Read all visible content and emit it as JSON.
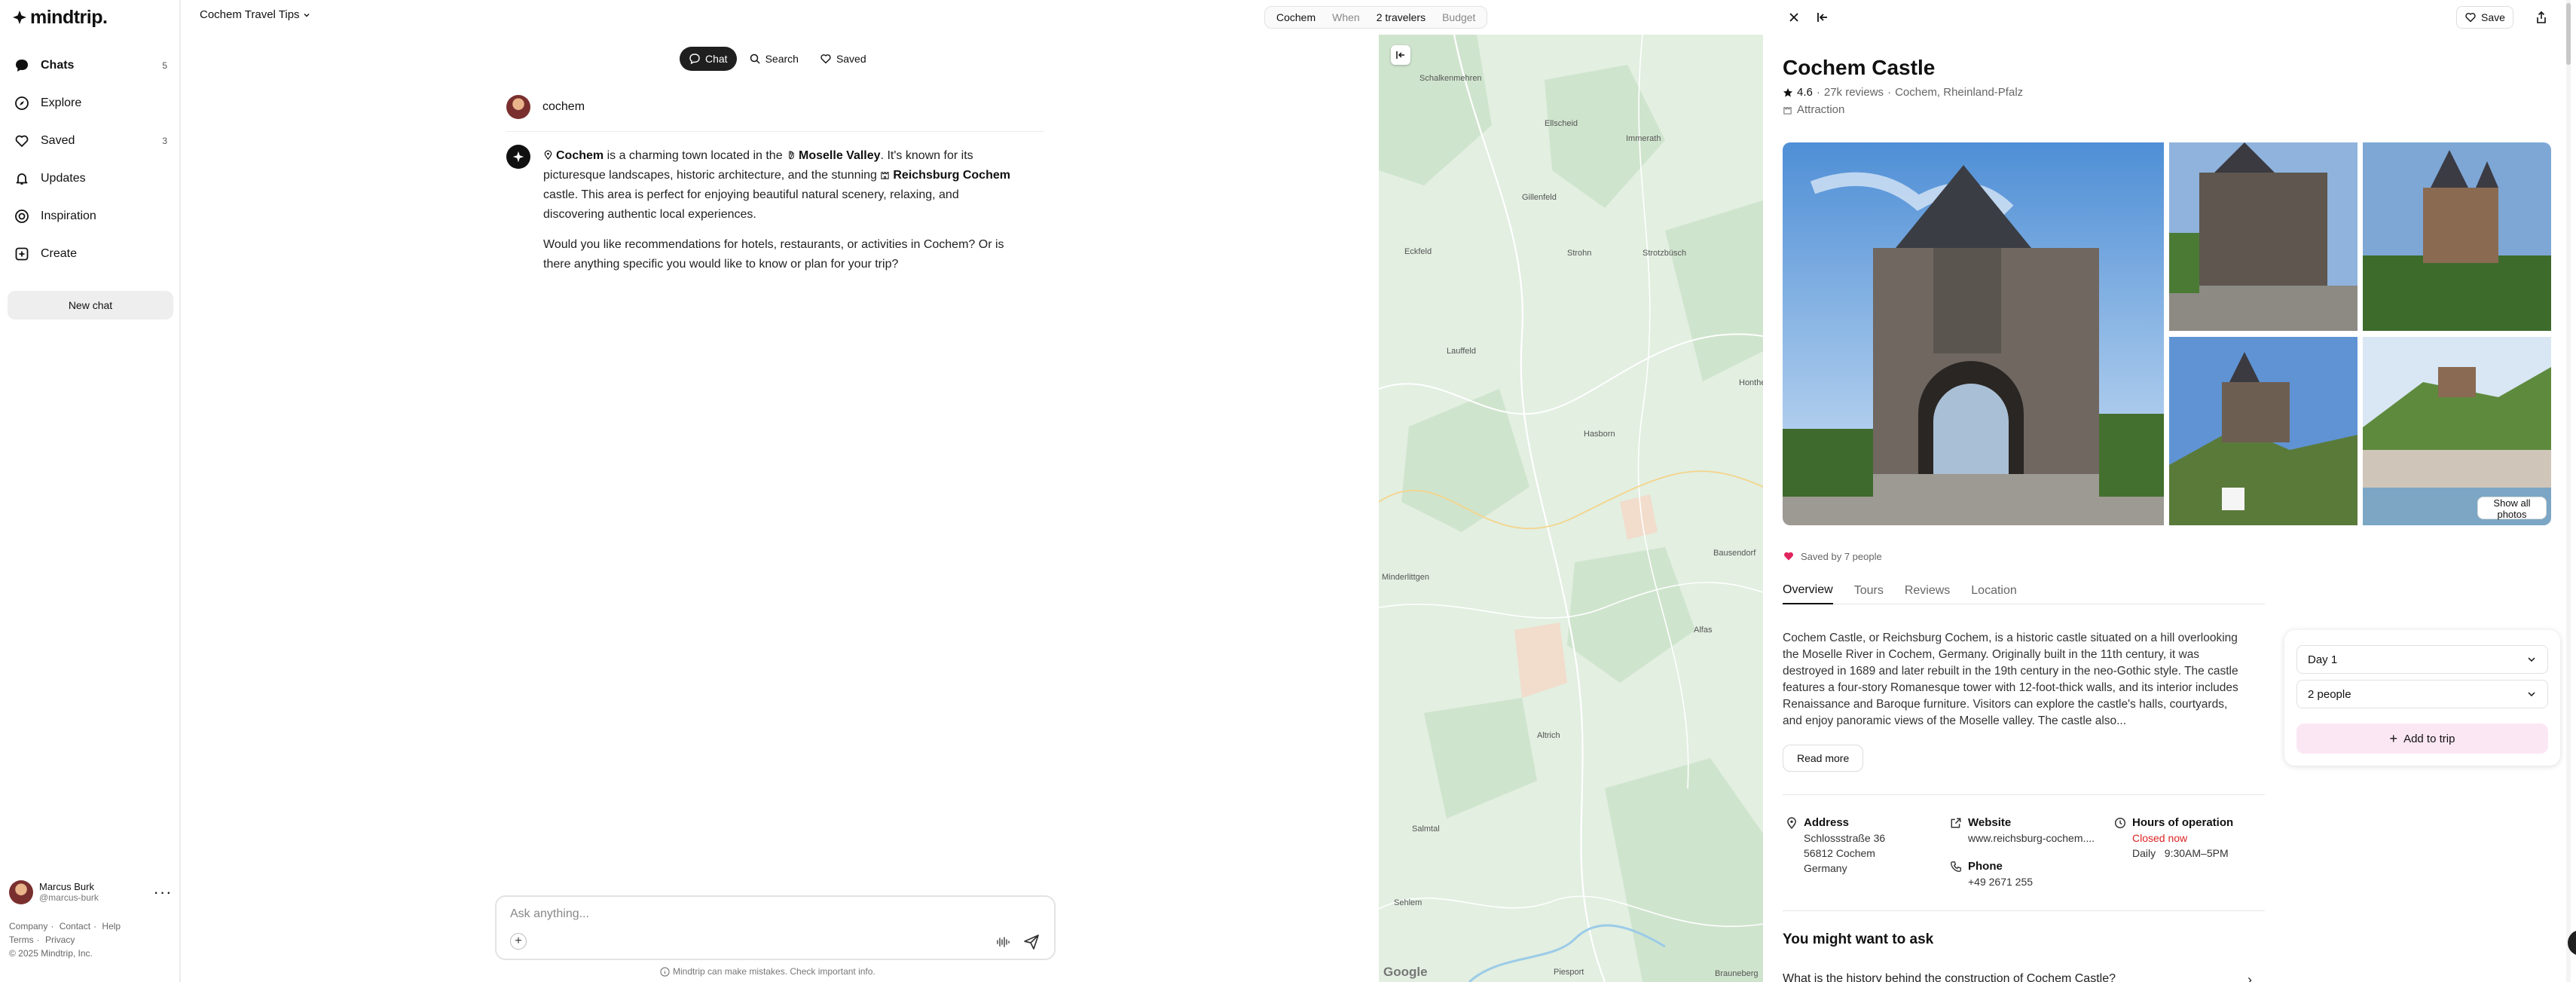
{
  "app": {
    "logo_text": "mindtrip."
  },
  "sidebar": {
    "items": [
      {
        "label": "Chats",
        "count": "5",
        "icon": "chat-bubble-icon"
      },
      {
        "label": "Explore",
        "count": "",
        "icon": "compass-icon"
      },
      {
        "label": "Saved",
        "count": "3",
        "icon": "heart-icon"
      },
      {
        "label": "Updates",
        "count": "",
        "icon": "bell-icon"
      },
      {
        "label": "Inspiration",
        "count": "",
        "icon": "target-icon"
      },
      {
        "label": "Create",
        "count": "",
        "icon": "plus-square-icon"
      }
    ],
    "new_chat": "New chat",
    "user": {
      "name": "Marcus Burk",
      "handle": "@marcus-burk"
    },
    "footer": {
      "company": "Company",
      "contact": "Contact",
      "help": "Help",
      "terms": "Terms",
      "privacy": "Privacy",
      "copyright": "© 2025 Mindtrip, Inc."
    }
  },
  "topbar": {
    "chat_title": "Cochem Travel Tips",
    "trip": {
      "place": "Cochem",
      "when": "When",
      "travelers": "2 travelers",
      "budget": "Budget"
    }
  },
  "chat": {
    "tabs": {
      "chat": "Chat",
      "search": "Search",
      "saved": "Saved"
    },
    "user_message": "cochem",
    "bot": {
      "p1": {
        "place1": "Cochem",
        "t1": " is a charming town located in the ",
        "place2": "Moselle Valley",
        "t2": ". It's known for its picturesque landscapes, historic architecture, and the stunning ",
        "place3": "Reichsburg Cochem",
        "t3": " castle. This area is perfect for enjoying beautiful natural scenery, relaxing, and discovering authentic local experiences."
      },
      "p2": "Would you like recommendations for hotels, restaurants, or activities in Cochem? Or is there anything specific you would like to know or plan for your trip?"
    },
    "composer": {
      "placeholder": "Ask anything..."
    },
    "disclaimer": "Mindtrip can make mistakes. Check important info."
  },
  "map": {
    "labels": [
      "Schalkenmehren",
      "Ellscheid",
      "Immerath",
      "Gillenfeld",
      "Strohn",
      "Strotzbüsch",
      "Eckfeld",
      "Lauffeld",
      "Hontheim",
      "Hasborn",
      "Bausendorf",
      "Minderlittgen",
      "Alfas",
      "Altrich",
      "Salmtal",
      "Sehlem",
      "Piesport",
      "Brauneberg"
    ],
    "attribution": "Google"
  },
  "place": {
    "save": "Save",
    "name": "Cochem Castle",
    "rating": "4.6",
    "reviews": "27k reviews",
    "location": "Cochem, Rheinland-Pfalz",
    "category": "Attraction",
    "show_all_photos": "Show all photos",
    "saved_by": "Saved by 7 people",
    "tabs": [
      "Overview",
      "Tours",
      "Reviews",
      "Location"
    ],
    "description": "Cochem Castle, or Reichsburg Cochem, is a historic castle situated on a hill overlooking the Moselle River in Cochem, Germany. Originally built in the 11th century, it was destroyed in 1689 and later rebuilt in the 19th century in the neo-Gothic style. The castle features a four-story Romanesque tower with 12-foot-thick walls, and its interior includes Renaissance and Baroque furniture. Visitors can explore the castle's halls, courtyards, and enjoy panoramic views of the Moselle valley. The castle also...",
    "read_more": "Read more",
    "address": {
      "label": "Address",
      "line1": "Schlossstraße 36",
      "line2": "56812 Cochem",
      "line3": "Germany"
    },
    "website": {
      "label": "Website",
      "value": "www.reichsburg-cochem...."
    },
    "phone": {
      "label": "Phone",
      "value": "+49 2671 255"
    },
    "hours": {
      "label": "Hours of operation",
      "status": "Closed now",
      "days": "Daily",
      "time": "9:30AM–5PM"
    },
    "ask_title": "You might want to ask",
    "ask_question": "What is the history behind the construction of Cochem Castle?"
  },
  "trip_card": {
    "day": "Day 1",
    "people": "2 people",
    "add": "Add to trip"
  },
  "colors": {
    "accent_pink": "#fbe7f4",
    "heart_red": "#e0245e",
    "closed_red": "#d22222",
    "map_green": "#dfeee0"
  }
}
